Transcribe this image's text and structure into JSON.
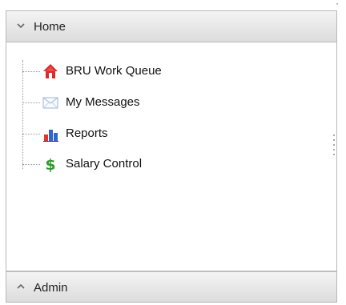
{
  "navigation": {
    "home_section": {
      "label": "Home",
      "items": [
        {
          "label": "BRU Work Queue",
          "icon": "house-icon"
        },
        {
          "label": "My Messages",
          "icon": "envelope-icon"
        },
        {
          "label": "Reports",
          "icon": "bar-chart-icon"
        },
        {
          "label": "Salary Control",
          "icon": "dollar-icon"
        }
      ]
    },
    "admin_section": {
      "label": "Admin"
    }
  },
  "colors": {
    "house_red": "#d92b2b",
    "envelope_blue": "#b8cde4",
    "chart_red": "#d83a2e",
    "chart_blue": "#2f67c8",
    "dollar_green": "#2f9a2f"
  }
}
